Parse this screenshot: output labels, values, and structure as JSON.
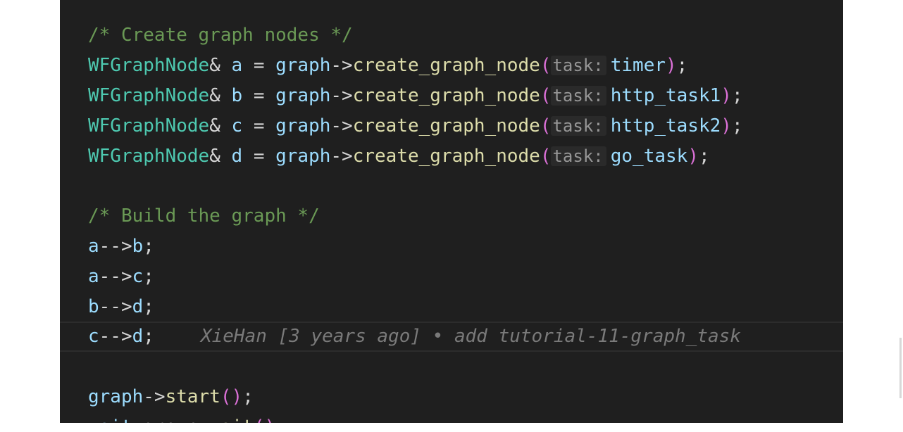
{
  "editor": {
    "comment_nodes": "/* Create graph nodes */",
    "nodes": [
      {
        "type": "WFGraphNode",
        "amp": "&",
        "var": "a",
        "eq": "=",
        "obj": "graph",
        "arrow": "->",
        "func": "create_graph_node",
        "open": "(",
        "hint": "task:",
        "arg": "timer",
        "close": ")",
        "semi": ";"
      },
      {
        "type": "WFGraphNode",
        "amp": "&",
        "var": "b",
        "eq": "=",
        "obj": "graph",
        "arrow": "->",
        "func": "create_graph_node",
        "open": "(",
        "hint": "task:",
        "arg": "http_task1",
        "close": ")",
        "semi": ";"
      },
      {
        "type": "WFGraphNode",
        "amp": "&",
        "var": "c",
        "eq": "=",
        "obj": "graph",
        "arrow": "->",
        "func": "create_graph_node",
        "open": "(",
        "hint": "task:",
        "arg": "http_task2",
        "close": ")",
        "semi": ";"
      },
      {
        "type": "WFGraphNode",
        "amp": "&",
        "var": "d",
        "eq": "=",
        "obj": "graph",
        "arrow": "->",
        "func": "create_graph_node",
        "open": "(",
        "hint": "task:",
        "arg": "go_task",
        "close": ")",
        "semi": ";"
      }
    ],
    "comment_build": "/* Build the graph */",
    "edges": [
      {
        "from": "a",
        "op": "-->",
        "to": "b",
        "semi": ";"
      },
      {
        "from": "a",
        "op": "-->",
        "to": "c",
        "semi": ";"
      },
      {
        "from": "b",
        "op": "-->",
        "to": "d",
        "semi": ";"
      },
      {
        "from": "c",
        "op": "-->",
        "to": "d",
        "semi": ";"
      }
    ],
    "blame": "XieHan [3 years ago] • add tutorial-11-graph_task",
    "start_line": {
      "obj": "graph",
      "arrow": "->",
      "func": "start",
      "parens": "()",
      "semi": ";"
    },
    "partial_line": {
      "obj": "wait",
      "arrow": "_group.",
      "func": "wait",
      "parens": "()",
      "semi": ";"
    }
  }
}
